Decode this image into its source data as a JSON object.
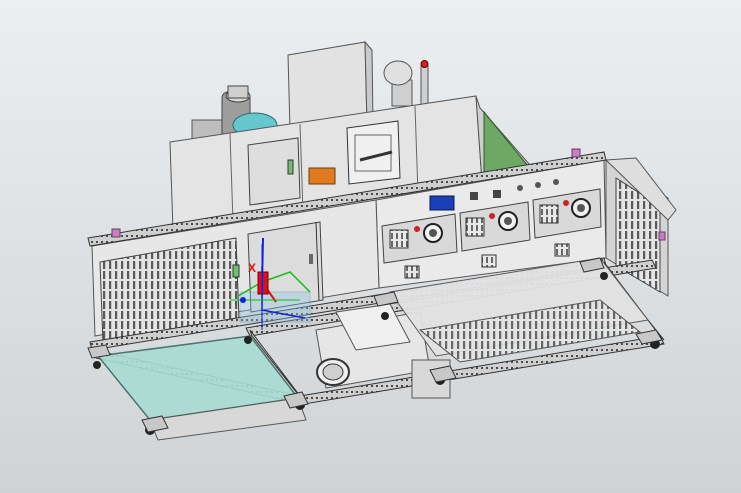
{
  "viewport": {
    "background_top": "#eceff1",
    "background_bottom": "#d0d3d6"
  },
  "model": {
    "frame_color": "#dcdcdc",
    "panel_color": "#e6e6e6",
    "door_glass_color": "#a9dcd4",
    "door_green_color": "#6fa865",
    "orange_label_color": "#e07a1e",
    "blue_display_color": "#1c3fb8",
    "warning_light_color": "#d42020",
    "pink_marker_color": "#c77fbf",
    "power_modules": 3
  },
  "triad": {
    "x_label": "X",
    "x_color": "#e01010",
    "y_color": "#10c010",
    "z_color": "#1020e0"
  }
}
